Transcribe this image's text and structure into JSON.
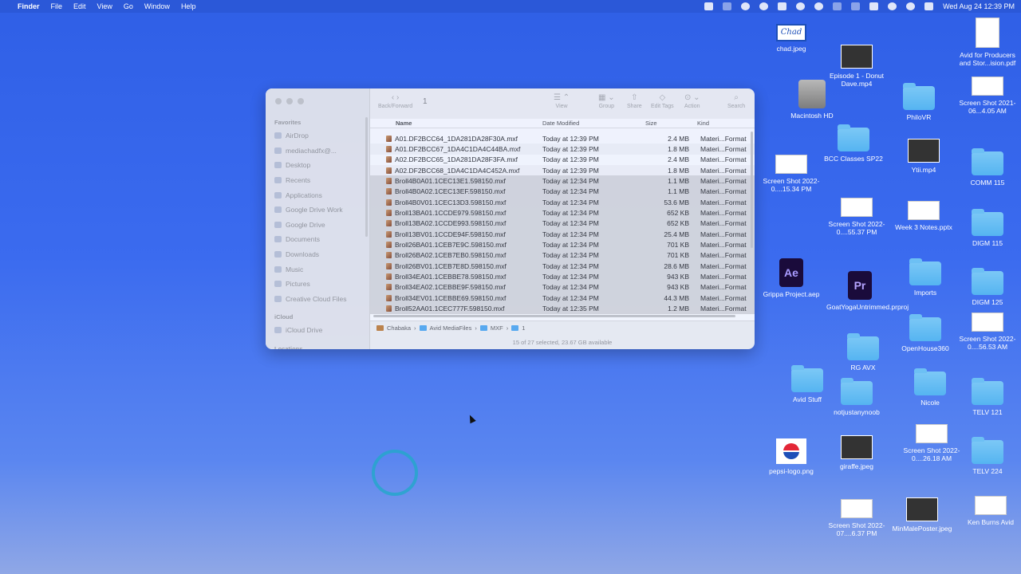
{
  "menubar": {
    "apple": "",
    "items": [
      "Finder",
      "File",
      "Edit",
      "View",
      "Go",
      "Window",
      "Help"
    ],
    "clock": "Wed Aug 24  12:39 PM"
  },
  "finder": {
    "title": "1",
    "toolbar": {
      "back_forward": "Back/Forward",
      "view": "View",
      "group": "Group",
      "share": "Share",
      "edit_tags": "Edit Tags",
      "action": "Action",
      "search": "Search"
    },
    "sidebar": {
      "favorites_label": "Favorites",
      "favorites": [
        "AirDrop",
        "mediachadfx@...",
        "Desktop",
        "Recents",
        "Applications",
        "Google Drive Work",
        "Google Drive",
        "Documents",
        "Downloads",
        "Music",
        "Pictures",
        "Creative Cloud Files"
      ],
      "icloud_label": "iCloud",
      "icloud": [
        "iCloud Drive"
      ],
      "locations_label": "Locations"
    },
    "columns": {
      "name": "Name",
      "date": "Date Modified",
      "size": "Size",
      "kind": "Kind"
    },
    "files": [
      {
        "name": "A01.DF2BCC64_1DA281DA28F30A.mxf",
        "date": "Today at 12:39 PM",
        "size": "2.4 MB",
        "kind": "Materi...Format",
        "selected": false
      },
      {
        "name": "A01.DF2BCC67_1DA4C1DA4C44BA.mxf",
        "date": "Today at 12:39 PM",
        "size": "1.8 MB",
        "kind": "Materi...Format",
        "selected": false
      },
      {
        "name": "A02.DF2BCC65_1DA281DA28F3FA.mxf",
        "date": "Today at 12:39 PM",
        "size": "2.4 MB",
        "kind": "Materi...Format",
        "selected": false
      },
      {
        "name": "A02.DF2BCC68_1DA4C1DA4C452A.mxf",
        "date": "Today at 12:39 PM",
        "size": "1.8 MB",
        "kind": "Materi...Format",
        "selected": false
      },
      {
        "name": "Broll4B0A01.1CEC13E1.598150.mxf",
        "date": "Today at 12:34 PM",
        "size": "1.1 MB",
        "kind": "Materi...Format",
        "selected": true
      },
      {
        "name": "Broll4B0A02.1CEC13EF.598150.mxf",
        "date": "Today at 12:34 PM",
        "size": "1.1 MB",
        "kind": "Materi...Format",
        "selected": true
      },
      {
        "name": "Broll4B0V01.1CEC13D3.598150.mxf",
        "date": "Today at 12:34 PM",
        "size": "53.6 MB",
        "kind": "Materi...Format",
        "selected": true
      },
      {
        "name": "Broll13BA01.1CCDE979.598150.mxf",
        "date": "Today at 12:34 PM",
        "size": "652 KB",
        "kind": "Materi...Format",
        "selected": true
      },
      {
        "name": "Broll13BA02.1CCDE993.598150.mxf",
        "date": "Today at 12:34 PM",
        "size": "652 KB",
        "kind": "Materi...Format",
        "selected": true
      },
      {
        "name": "Broll13BV01.1CCDE94F.598150.mxf",
        "date": "Today at 12:34 PM",
        "size": "25.4 MB",
        "kind": "Materi...Format",
        "selected": true
      },
      {
        "name": "Broll26BA01.1CEB7E9C.598150.mxf",
        "date": "Today at 12:34 PM",
        "size": "701 KB",
        "kind": "Materi...Format",
        "selected": true
      },
      {
        "name": "Broll26BA02.1CEB7EB0.598150.mxf",
        "date": "Today at 12:34 PM",
        "size": "701 KB",
        "kind": "Materi...Format",
        "selected": true
      },
      {
        "name": "Broll26BV01.1CEB7E8D.598150.mxf",
        "date": "Today at 12:34 PM",
        "size": "28.6 MB",
        "kind": "Materi...Format",
        "selected": true
      },
      {
        "name": "Broll34EA01.1CEBBE78.598150.mxf",
        "date": "Today at 12:34 PM",
        "size": "943 KB",
        "kind": "Materi...Format",
        "selected": true
      },
      {
        "name": "Broll34EA02.1CEBBE9F.598150.mxf",
        "date": "Today at 12:34 PM",
        "size": "943 KB",
        "kind": "Materi...Format",
        "selected": true
      },
      {
        "name": "Broll34EV01.1CEBBE69.598150.mxf",
        "date": "Today at 12:34 PM",
        "size": "44.3 MB",
        "kind": "Materi...Format",
        "selected": true
      },
      {
        "name": "Broll52AA01.1CEC777F.598150.mxf",
        "date": "Today at 12:35 PM",
        "size": "1.2 MB",
        "kind": "Materi...Format",
        "selected": true
      }
    ],
    "path": [
      "Chabaka",
      "Avid MediaFiles",
      "MXF",
      "1"
    ],
    "status": "15 of 27 selected, 23.67 GB available"
  },
  "desktop": {
    "items": [
      {
        "label": "chad.jpeg",
        "icon": "chad-image"
      },
      {
        "label": "Episode 1 - Donut Dave.mp4",
        "icon": "video-thumb"
      },
      {
        "label": "Avid for Producers and Stor...ision.pdf",
        "icon": "pdf-doc"
      },
      {
        "label": "Macintosh HD",
        "icon": "hard-drive"
      },
      {
        "label": "PhiloVR",
        "icon": "folder"
      },
      {
        "label": "Screen Shot 2021-06...4.05 AM",
        "icon": "screenshot"
      },
      {
        "label": "BCC Classes SP22",
        "icon": "folder"
      },
      {
        "label": "Screen Shot 2022-0....15.34 PM",
        "icon": "screenshot"
      },
      {
        "label": "Ytii.mp4",
        "icon": "video-thumb"
      },
      {
        "label": "COMM 115",
        "icon": "folder"
      },
      {
        "label": "Screen Shot 2022-0....55.37 PM",
        "icon": "screenshot"
      },
      {
        "label": "Week 3 Notes.pptx",
        "icon": "pptx-doc"
      },
      {
        "label": "DIGM 115",
        "icon": "folder"
      },
      {
        "label": "Grippa Project.aep",
        "icon": "after-effects"
      },
      {
        "label": "GoatYogaUntrimmed.prproj",
        "icon": "premiere"
      },
      {
        "label": "Imports",
        "icon": "folder"
      },
      {
        "label": "DIGM 125",
        "icon": "folder"
      },
      {
        "label": "OpenHouse360",
        "icon": "folder"
      },
      {
        "label": "Screen Shot 2022-0....56.53 AM",
        "icon": "screenshot"
      },
      {
        "label": "RG AVX",
        "icon": "folder"
      },
      {
        "label": "Avid Stuff",
        "icon": "folder"
      },
      {
        "label": "notjustanynoob",
        "icon": "folder"
      },
      {
        "label": "Nicole",
        "icon": "folder"
      },
      {
        "label": "TELV 121",
        "icon": "folder"
      },
      {
        "label": "Screen Shot 2022-0....26.18 AM",
        "icon": "screenshot"
      },
      {
        "label": "pepsi-logo.png",
        "icon": "pepsi-image"
      },
      {
        "label": "giraffe.jpeg",
        "icon": "photo"
      },
      {
        "label": "TELV 224",
        "icon": "folder"
      },
      {
        "label": "Screen Shot 2022-07....6.37 PM",
        "icon": "screenshot"
      },
      {
        "label": "MinMalePoster.jpeg",
        "icon": "photo"
      },
      {
        "label": "Ken Burns Avid",
        "icon": "screenshot"
      }
    ]
  }
}
